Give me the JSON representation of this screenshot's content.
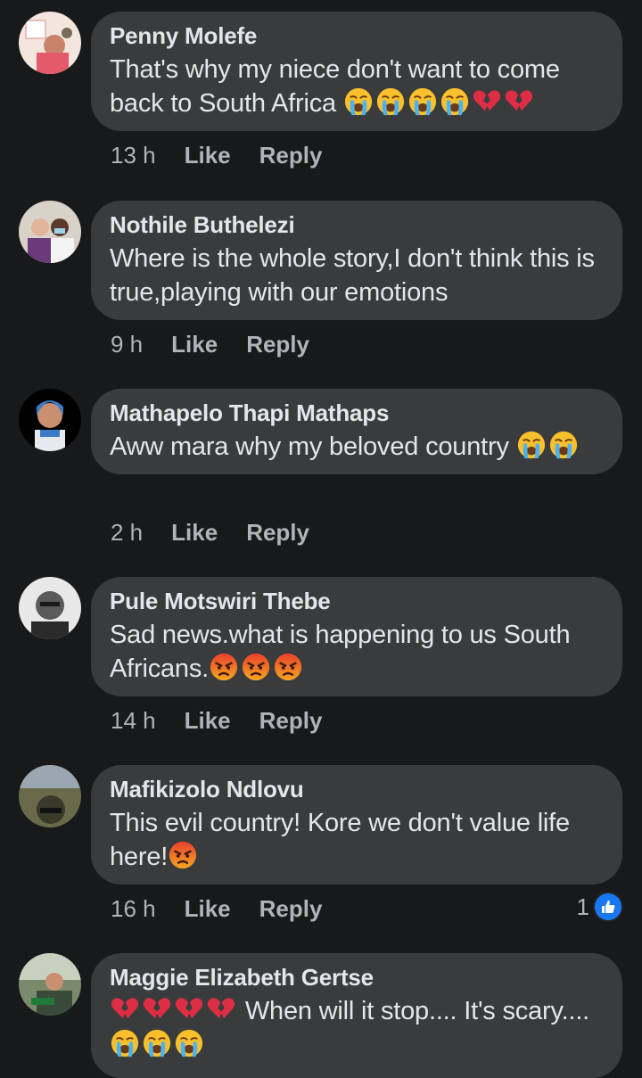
{
  "comments": [
    {
      "author": "Penny Molefe",
      "text": "That's why my niece don't want to come back to South Africa",
      "emojis": [
        "crying-face",
        "crying-face",
        "crying-face",
        "crying-face",
        "broken-heart",
        "broken-heart"
      ],
      "time": "13 h",
      "like_label": "Like",
      "reply_label": "Reply"
    },
    {
      "author": "Nothile Buthelezi",
      "text": "Where is the whole story,I don't think this is true,playing with our emotions",
      "emojis": [],
      "time": "9 h",
      "like_label": "Like",
      "reply_label": "Reply"
    },
    {
      "author": "Mathapelo Thapi Mathaps",
      "text": "Aww mara why my beloved country",
      "emojis": [
        "crying-face",
        "crying-face"
      ],
      "time": "2 h",
      "like_label": "Like",
      "reply_label": "Reply"
    },
    {
      "author": "Pule Motswiri Thebe",
      "text": "Sad news.what is happening to us South Africans.",
      "emojis": [
        "angry-face",
        "angry-face",
        "angry-face"
      ],
      "time": "14 h",
      "like_label": "Like",
      "reply_label": "Reply"
    },
    {
      "author": "Mafikizolo Ndlovu",
      "text": "This evil country! Kore we don't value life here!",
      "emojis": [
        "angry-face"
      ],
      "time": "16 h",
      "like_label": "Like",
      "reply_label": "Reply",
      "reaction_count": "1",
      "reaction_icon": "like-thumb-icon"
    },
    {
      "author": "Maggie Elizabeth Gertse",
      "text_before_emojis": "",
      "lead_emojis": [
        "broken-heart",
        "broken-heart",
        "broken-heart",
        "broken-heart"
      ],
      "text": "When will it stop.... It's scary....",
      "emojis": [
        "crying-face",
        "crying-face",
        "crying-face"
      ]
    }
  ],
  "colors": {
    "background": "#18191a",
    "bubble": "#3a3b3c",
    "text": "#e4e6eb",
    "secondary_text": "#b0b3b8",
    "like_blue": "#1877f2"
  }
}
